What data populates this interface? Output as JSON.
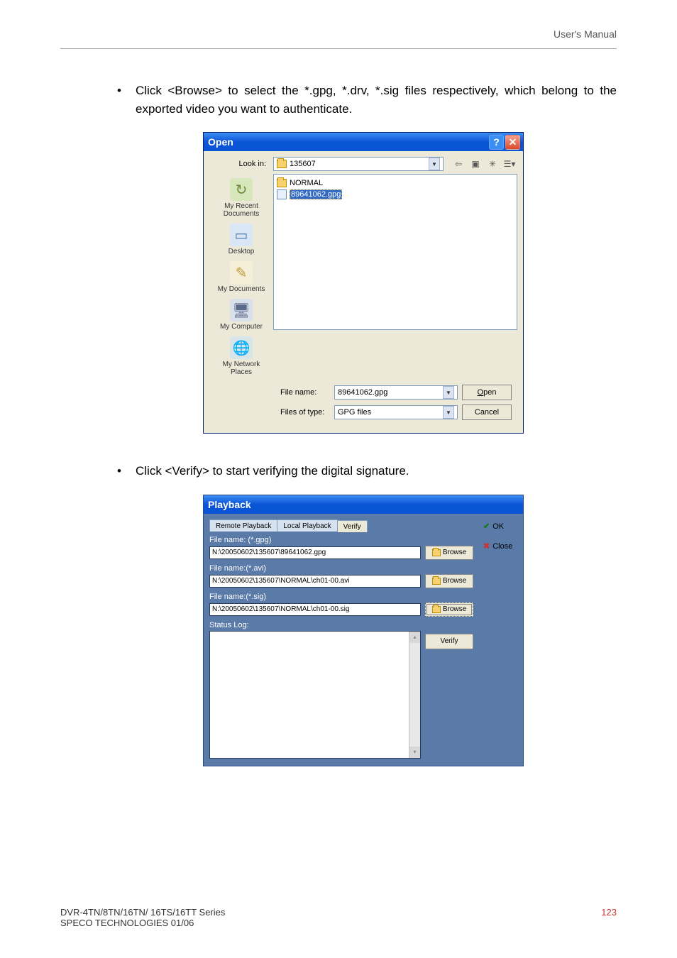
{
  "header": {
    "right": "User's Manual"
  },
  "body": {
    "bullet1": "Click <Browse> to select the *.gpg, *.drv, *.sig files respectively, which belong to the exported video you want to authenticate.",
    "bullet2": "Click <Verify> to start verifying the digital signature."
  },
  "open_dialog": {
    "title": "Open",
    "lookin_label": "Look in:",
    "lookin_value": "135607",
    "toolbar": {
      "back": "⇦",
      "up": "▣",
      "newfolder": "✳",
      "views": "☰▾"
    },
    "places": [
      {
        "name": "My Recent Documents",
        "glyph": "↻"
      },
      {
        "name": "Desktop",
        "glyph": "▭"
      },
      {
        "name": "My Documents",
        "glyph": "✎"
      },
      {
        "name": "My Computer",
        "glyph": "🖥"
      },
      {
        "name": "My Network Places",
        "glyph": "🌐"
      }
    ],
    "files": [
      {
        "type": "folder",
        "name": "NORMAL"
      },
      {
        "type": "gpg",
        "name": "89641062.gpg",
        "selected": true
      }
    ],
    "filename_label": "File name:",
    "filename_value": "89641062.gpg",
    "filetype_label": "Files of type:",
    "filetype_value": "GPG files",
    "open_btn": "Open",
    "open_btn_underline": "O",
    "open_btn_rest": "pen",
    "cancel_btn": "Cancel"
  },
  "playback_dialog": {
    "title": "Playback",
    "tabs": [
      "Remote Playback",
      "Local Playback",
      "Verify"
    ],
    "active_tab_index": 2,
    "ok_label": "OK",
    "close_label": "Close",
    "gpg_label": "File name: (*.gpg)",
    "gpg_value": "N:\\20050602\\135607\\89641062.gpg",
    "avi_label": "File name:(*.avi)",
    "avi_value": "N:\\20050602\\135607\\NORMAL\\ch01-00.avi",
    "sig_label": "File name:(*.sig)",
    "sig_value": "N:\\20050602\\135607\\NORMAL\\ch01-00.sig",
    "browse_label": "Browse",
    "status_label": "Status Log:",
    "verify_label": "Verify"
  },
  "footer": {
    "left1": "DVR-4TN/8TN/16TN/ 16TS/16TT Series",
    "left2": "SPECO TECHNOLOGIES 01/06",
    "page": "123"
  }
}
